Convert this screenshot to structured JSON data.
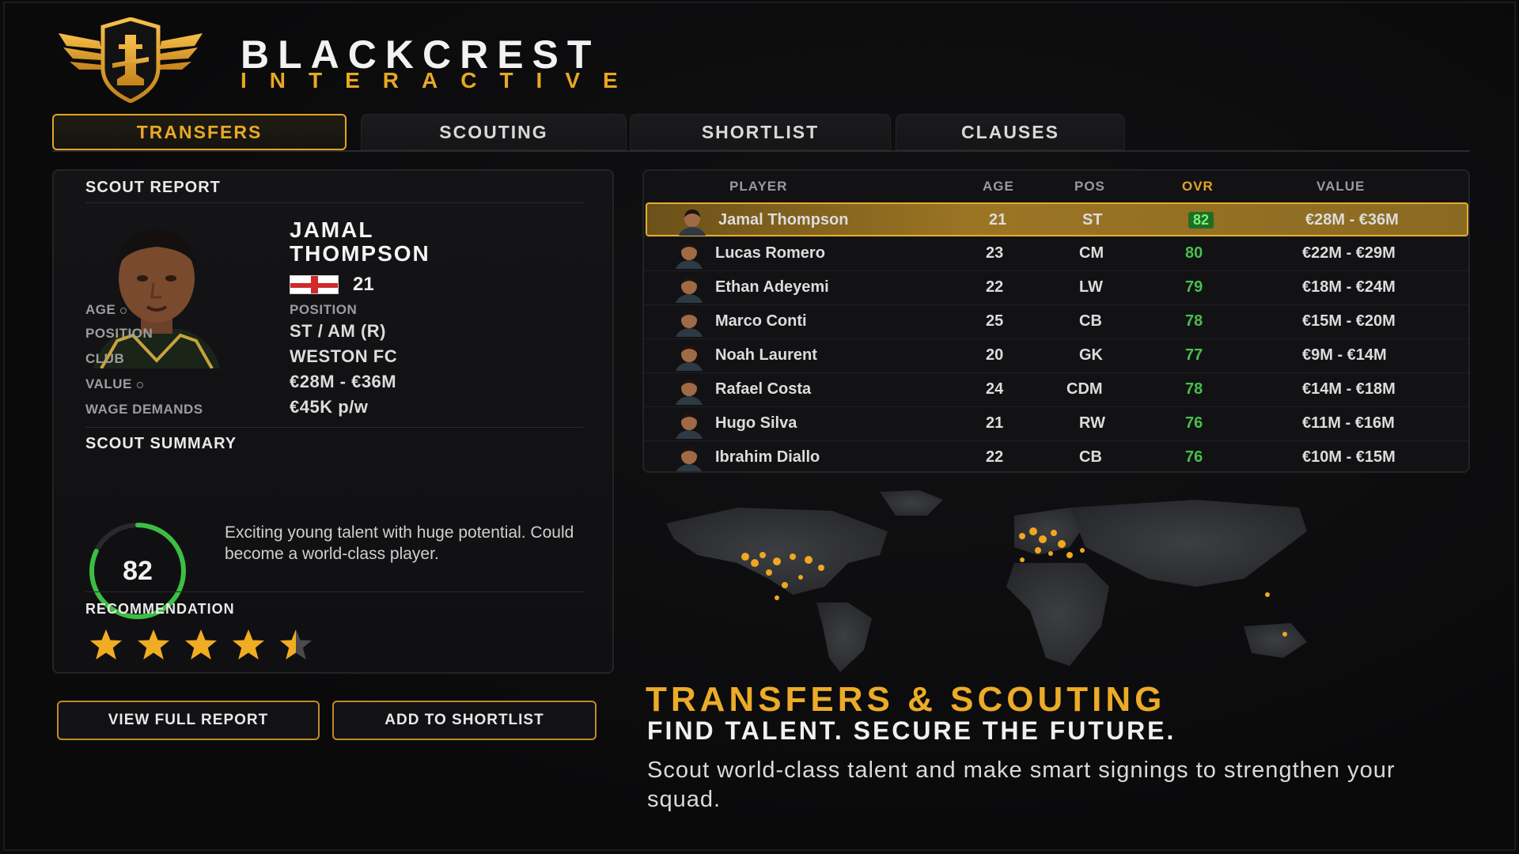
{
  "brand": {
    "title": "BLACKCREST",
    "subtitle": "INTERACTIVE"
  },
  "tabs": [
    {
      "label": "TRANSFERS",
      "active": true
    },
    {
      "label": "SCOUTING",
      "active": false
    },
    {
      "label": "SHORTLIST",
      "active": false
    },
    {
      "label": "CLAUSES",
      "active": false
    }
  ],
  "scout_report": {
    "heading": "SCOUT REPORT",
    "name_first": "JAMAL",
    "name_last": "THOMPSON",
    "flag": "england-flag",
    "age": "21",
    "labels": {
      "age": "AGE",
      "position_header": "POSITION",
      "position": "POSITION",
      "club": "CLUB",
      "value": "VALUE",
      "wage": "WAGE DEMANDS"
    },
    "values": {
      "position": "ST / AM (R)",
      "club": "WESTON FC",
      "value": "€28M - €36M",
      "wage": "€45K p/w"
    },
    "summary_heading": "SCOUT SUMMARY",
    "score": "82",
    "summary_text": "Exciting young talent with huge potential. Could become a world-class player.",
    "recommendation_heading": "RECOMMENDATION",
    "stars": 4.5
  },
  "buttons": {
    "view_report": "VIEW FULL REPORT",
    "add_shortlist": "ADD TO SHORTLIST"
  },
  "table": {
    "headers": {
      "player": "PLAYER",
      "age": "AGE",
      "pos": "POS",
      "ovr": "OVR",
      "value": "VALUE"
    },
    "rows": [
      {
        "name": "Jamal Thompson",
        "age": "21",
        "pos": "ST",
        "ovr": "82",
        "value": "€28M - €36M",
        "selected": true
      },
      {
        "name": "Lucas Romero",
        "age": "23",
        "pos": "CM",
        "ovr": "80",
        "value": "€22M - €29M"
      },
      {
        "name": "Ethan Adeyemi",
        "age": "22",
        "pos": "LW",
        "ovr": "79",
        "value": "€18M - €24M"
      },
      {
        "name": "Marco Conti",
        "age": "25",
        "pos": "CB",
        "ovr": "78",
        "value": "€15M - €20M"
      },
      {
        "name": "Noah Laurent",
        "age": "20",
        "pos": "GK",
        "ovr": "77",
        "value": "€9M - €14M"
      },
      {
        "name": "Rafael Costa",
        "age": "24",
        "pos": "CDM",
        "ovr": "78",
        "value": "€14M - €18M"
      },
      {
        "name": "Hugo Silva",
        "age": "21",
        "pos": "RW",
        "ovr": "76",
        "value": "€11M - €16M"
      },
      {
        "name": "Ibrahim Diallo",
        "age": "22",
        "pos": "CB",
        "ovr": "76",
        "value": "€10M - €15M"
      }
    ]
  },
  "marketing": {
    "title": "TRANSFERS & SCOUTING",
    "subtitle": "FIND TALENT. SECURE THE FUTURE.",
    "description": "Scout world-class talent and make smart signings to strengthen your squad."
  },
  "colors": {
    "accent": "#e7a823",
    "ovr_green": "#48c04c",
    "background": "#0b0b0c"
  }
}
